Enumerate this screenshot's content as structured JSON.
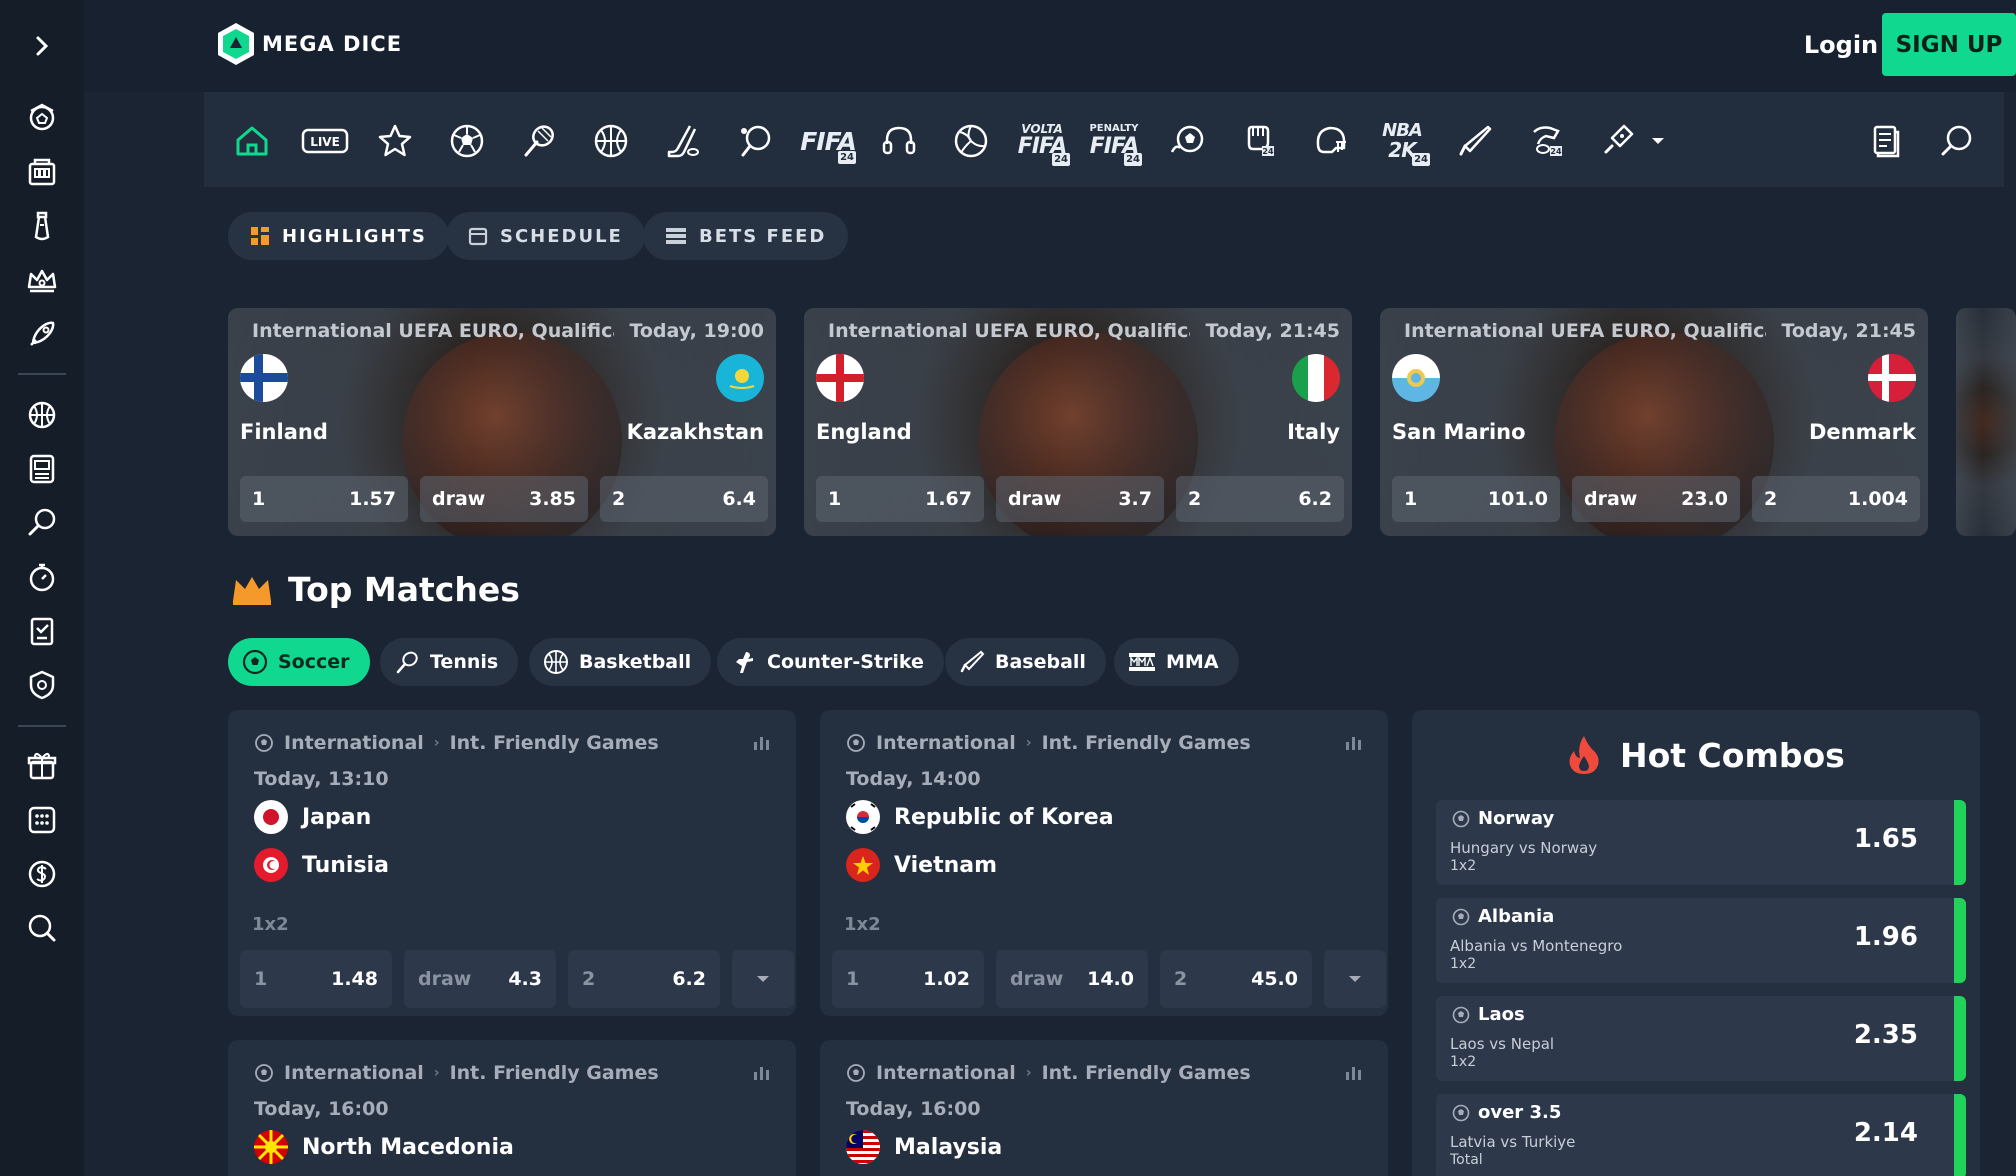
{
  "brand": {
    "name": "MEGA DICE"
  },
  "auth": {
    "login": "Login",
    "signup": "SIGN UP"
  },
  "sportbar": {
    "live": "LIVE",
    "fifa": "FIFA",
    "volta_top": "VOLTA",
    "penalty_top": "PENALTY",
    "nba": "NBA",
    "nba_sub": "2K",
    "badge": "24"
  },
  "tabs": [
    {
      "label": "HIGHLIGHTS"
    },
    {
      "label": "SCHEDULE"
    },
    {
      "label": "BETS FEED"
    }
  ],
  "highlights": [
    {
      "league": "International  UEFA EURO, Qualification",
      "time": "Today, 19:00",
      "home": "Finland",
      "away": "Kazakhstan",
      "odds": [
        {
          "label": "1",
          "value": "1.57"
        },
        {
          "label": "draw",
          "value": "3.85"
        },
        {
          "label": "2",
          "value": "6.4"
        }
      ]
    },
    {
      "league": "International  UEFA EURO, Qualification",
      "time": "Today, 21:45",
      "home": "England",
      "away": "Italy",
      "odds": [
        {
          "label": "1",
          "value": "1.67"
        },
        {
          "label": "draw",
          "value": "3.7"
        },
        {
          "label": "2",
          "value": "6.2"
        }
      ]
    },
    {
      "league": "International  UEFA EURO, Qualification",
      "time": "Today, 21:45",
      "home": "San Marino",
      "away": "Denmark",
      "odds": [
        {
          "label": "1",
          "value": "101.0"
        },
        {
          "label": "draw",
          "value": "23.0"
        },
        {
          "label": "2",
          "value": "1.004"
        }
      ]
    }
  ],
  "top_matches": {
    "title": "Top Matches",
    "sports": [
      {
        "label": "Soccer"
      },
      {
        "label": "Tennis"
      },
      {
        "label": "Basketball"
      },
      {
        "label": "Counter-Strike"
      },
      {
        "label": "Baseball"
      },
      {
        "label": "MMA"
      }
    ],
    "matches": [
      {
        "region": "International",
        "league": "Int. Friendly Games",
        "time": "Today, 13:10",
        "home": "Japan",
        "away": "Tunisia",
        "market": "1x2",
        "odds": [
          {
            "label": "1",
            "value": "1.48"
          },
          {
            "label": "draw",
            "value": "4.3"
          },
          {
            "label": "2",
            "value": "6.2"
          }
        ]
      },
      {
        "region": "International",
        "league": "Int. Friendly Games",
        "time": "Today, 14:00",
        "home": "Republic of Korea",
        "away": "Vietnam",
        "market": "1x2",
        "odds": [
          {
            "label": "1",
            "value": "1.02"
          },
          {
            "label": "draw",
            "value": "14.0"
          },
          {
            "label": "2",
            "value": "45.0"
          }
        ]
      },
      {
        "region": "International",
        "league": "Int. Friendly Games",
        "time": "Today, 16:00",
        "home": "North Macedonia"
      },
      {
        "region": "International",
        "league": "Int. Friendly Games",
        "time": "Today, 16:00",
        "home": "Malaysia"
      }
    ]
  },
  "hot_combos": {
    "title": "Hot Combos",
    "items": [
      {
        "name": "Norway",
        "match": "Hungary vs Norway",
        "market": "1x2",
        "odd": "1.65"
      },
      {
        "name": "Albania",
        "match": "Albania vs Montenegro",
        "market": "1x2",
        "odd": "1.96"
      },
      {
        "name": "Laos",
        "match": "Laos vs Nepal",
        "market": "1x2",
        "odd": "2.35"
      },
      {
        "name": "over 3.5",
        "match": "Latvia vs Turkiye",
        "market": "Total",
        "odd": "2.14"
      }
    ]
  },
  "colors": {
    "accent": "#10d98f",
    "combo_bar": "#21d35b",
    "crown": "#f39a2b",
    "fire": "#ef4a3c"
  }
}
